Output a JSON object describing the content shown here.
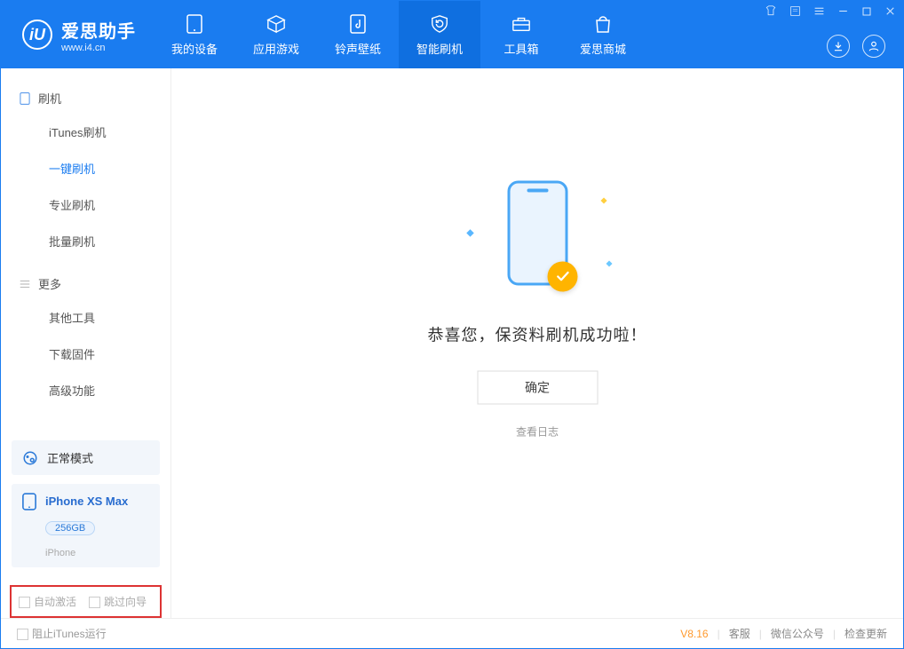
{
  "app": {
    "name_cn": "爱思助手",
    "url": "www.i4.cn",
    "logo_letter": "iU"
  },
  "nav": [
    {
      "id": "device",
      "label": "我的设备"
    },
    {
      "id": "apps",
      "label": "应用游戏"
    },
    {
      "id": "media",
      "label": "铃声壁纸"
    },
    {
      "id": "flash",
      "label": "智能刷机",
      "active": true
    },
    {
      "id": "tools",
      "label": "工具箱"
    },
    {
      "id": "store",
      "label": "爱思商城"
    }
  ],
  "sidebar": {
    "groups": [
      {
        "title": "刷机",
        "icon": "phone-icon",
        "items": [
          {
            "id": "itunes",
            "label": "iTunes刷机"
          },
          {
            "id": "oneclick",
            "label": "一键刷机",
            "active": true
          },
          {
            "id": "pro",
            "label": "专业刷机"
          },
          {
            "id": "batch",
            "label": "批量刷机"
          }
        ]
      },
      {
        "title": "更多",
        "icon": "more-icon",
        "items": [
          {
            "id": "other",
            "label": "其他工具"
          },
          {
            "id": "fw",
            "label": "下载固件"
          },
          {
            "id": "adv",
            "label": "高级功能"
          }
        ]
      }
    ],
    "mode": {
      "label": "正常模式"
    },
    "device": {
      "name": "iPhone XS Max",
      "storage": "256GB",
      "type": "iPhone"
    },
    "opts": {
      "auto_activate": "自动激活",
      "skip_guide": "跳过向导"
    }
  },
  "main": {
    "success_text": "恭喜您，保资料刷机成功啦！",
    "ok_label": "确定",
    "log_link": "查看日志"
  },
  "footer": {
    "block_itunes": "阻止iTunes运行",
    "version": "V8.16",
    "links": [
      "客服",
      "微信公众号",
      "检查更新"
    ]
  }
}
